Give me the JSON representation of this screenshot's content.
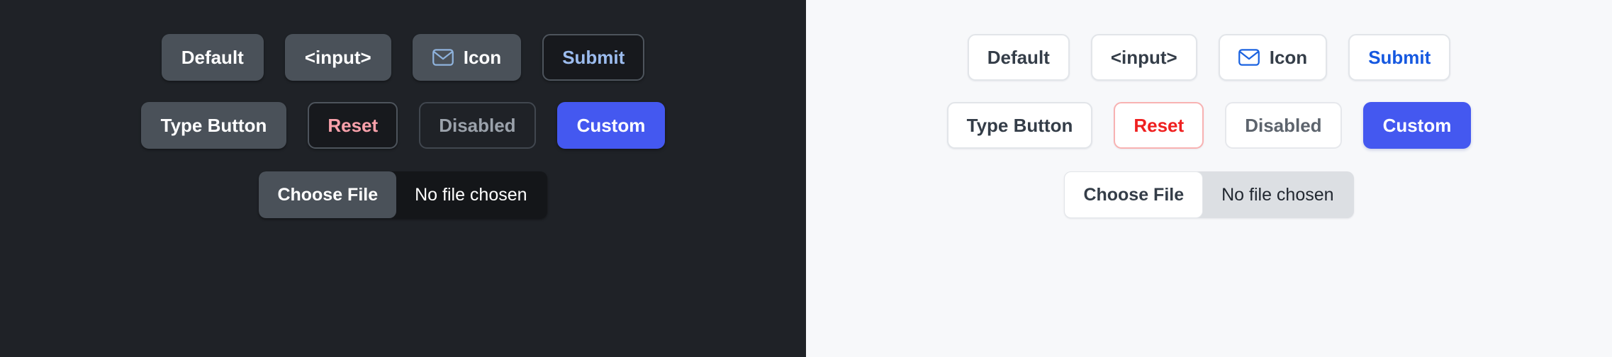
{
  "theme_colors": {
    "dark_background": "#1f2227",
    "light_background": "#f7f8fa",
    "dark_button_fill": "#4a5159",
    "dark_outline_fill": "#17191d",
    "dark_border": "#4d545c",
    "dark_submit_text": "#9cbcee",
    "dark_reset_text": "#f9a1ab",
    "dark_disabled_text": "#9ba2ab",
    "dark_icon_blue": "#8fb3dd",
    "light_button_fill": "#ffffff",
    "light_border": "#e2e5e9",
    "light_text": "#343d48",
    "light_submit_text": "#1558e0",
    "light_reset_text": "#ef2020",
    "light_reset_border": "#f8b2b2",
    "light_disabled_text": "#5d646d",
    "light_icon_blue": "#1a62e0",
    "light_file_track": "#dcdfe3",
    "accent_custom": "#4458f0"
  },
  "panels": {
    "dark": {
      "row1": [
        {
          "label": "Default",
          "name": "default-button"
        },
        {
          "label": "<input>",
          "name": "input-button"
        },
        {
          "label": "Icon",
          "name": "icon-button",
          "icon": "envelope-icon"
        },
        {
          "label": "Submit",
          "name": "submit-button"
        }
      ],
      "row2": [
        {
          "label": "Type Button",
          "name": "type-button"
        },
        {
          "label": "Reset",
          "name": "reset-button"
        },
        {
          "label": "Disabled",
          "name": "disabled-button"
        },
        {
          "label": "Custom",
          "name": "custom-button"
        }
      ],
      "file_input": {
        "button_label": "Choose File",
        "status_text": "No file chosen"
      }
    },
    "light": {
      "row1": [
        {
          "label": "Default",
          "name": "default-button"
        },
        {
          "label": "<input>",
          "name": "input-button"
        },
        {
          "label": "Icon",
          "name": "icon-button",
          "icon": "envelope-icon"
        },
        {
          "label": "Submit",
          "name": "submit-button"
        }
      ],
      "row2": [
        {
          "label": "Type Button",
          "name": "type-button"
        },
        {
          "label": "Reset",
          "name": "reset-button"
        },
        {
          "label": "Disabled",
          "name": "disabled-button"
        },
        {
          "label": "Custom",
          "name": "custom-button"
        }
      ],
      "file_input": {
        "button_label": "Choose File",
        "status_text": "No file chosen"
      }
    }
  }
}
